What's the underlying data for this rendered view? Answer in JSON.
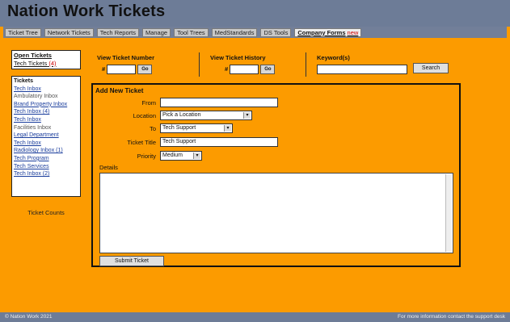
{
  "app": {
    "title": "Nation Work Tickets"
  },
  "nav": {
    "items": [
      {
        "label": "Ticket Tree"
      },
      {
        "label": "Network Tickets"
      },
      {
        "label": "Tech Reports"
      },
      {
        "label": "Manage"
      },
      {
        "label": "Tool Trees"
      },
      {
        "label": "MedStandards"
      },
      {
        "label": "DS Tools"
      },
      {
        "label": "Company Forms",
        "badge": "new"
      }
    ]
  },
  "left": {
    "open_tickets": "Open Tickets",
    "tech_tickets": "Tech Tickets",
    "tech_tickets_count": "(4)"
  },
  "depts": {
    "header": "Tickets",
    "items": [
      {
        "label": "Tech Inbox",
        "style": "link"
      },
      {
        "label": "Ambulatory Inbox",
        "style": "plain"
      },
      {
        "label": "Brand Property Inbox",
        "style": "link"
      },
      {
        "label": "Tech Inbox (4)",
        "style": "link"
      },
      {
        "label": "Tech Inbox",
        "style": "link"
      },
      {
        "label": "Facilities Inbox",
        "style": "plain"
      },
      {
        "label": "Legal Department",
        "style": "link"
      },
      {
        "label": "Tech Inbox",
        "style": "link"
      },
      {
        "label": "Radiology Inbox (1)",
        "style": "link"
      },
      {
        "label": "Tech Program",
        "style": "link"
      },
      {
        "label": "Tech Services",
        "style": "link"
      },
      {
        "label": "Tech Inbox (2)",
        "style": "link"
      }
    ]
  },
  "ticket_count": "Ticket Counts",
  "search": {
    "view_number_label": "View Ticket Number",
    "view_history_label": "View Ticket History",
    "keywords_label": "Keyword(s)",
    "hash1": "#",
    "hash2": "#",
    "go": "Go",
    "search_button": "Search"
  },
  "form": {
    "title": "Add New Ticket",
    "from_label": "From",
    "location_label": "Location",
    "location_value": "Pick a Location",
    "to_label": "To",
    "to_value": "Tech Support",
    "ticket_title_label": "Ticket Title",
    "ticket_title_value": "Tech Support",
    "priority_label": "Priority",
    "priority_value": "Medium",
    "details_label": "Details",
    "submit_label": "Submit Ticket"
  },
  "footer": {
    "left": "© Nation Work 2021",
    "right": "For more information contact the support desk"
  }
}
